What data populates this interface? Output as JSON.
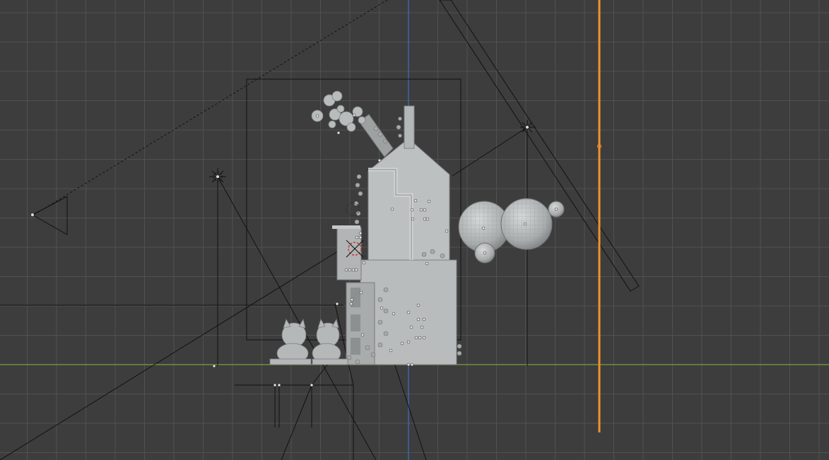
{
  "viewport": {
    "view": "front-orthographic",
    "grid": true,
    "colors": {
      "background": "#3d3d3d",
      "grid_minor": "#4a4a4a",
      "grid_major": "#515151",
      "x_axis": "#6f9139",
      "z_axis": "#3a6aa6",
      "selected_object": "#f0922c",
      "wire": "#111111",
      "mesh_fill": "#b8bbbb",
      "mesh_shade": "#8e9191"
    },
    "objects": [
      {
        "name": "camera",
        "type": "camera",
        "icon": "camera-icon"
      },
      {
        "name": "sun-lamp-left",
        "type": "light",
        "icon": "sun-light-icon"
      },
      {
        "name": "sun-lamp-right",
        "type": "light",
        "icon": "sun-light-icon"
      },
      {
        "name": "point-lamp",
        "type": "light",
        "icon": "point-light-icon"
      },
      {
        "name": "house",
        "type": "mesh"
      },
      {
        "name": "sphere-large-left",
        "type": "mesh"
      },
      {
        "name": "sphere-large-right",
        "type": "mesh"
      },
      {
        "name": "sphere-small-bottom",
        "type": "mesh"
      },
      {
        "name": "sphere-small-right",
        "type": "mesh"
      },
      {
        "name": "cat-figure-left",
        "type": "mesh"
      },
      {
        "name": "cat-figure-right",
        "type": "mesh"
      },
      {
        "name": "selected-plane",
        "type": "mesh",
        "selected": true
      },
      {
        "name": "3d-cursor",
        "type": "cursor",
        "icon": "3d-cursor-icon"
      }
    ]
  }
}
